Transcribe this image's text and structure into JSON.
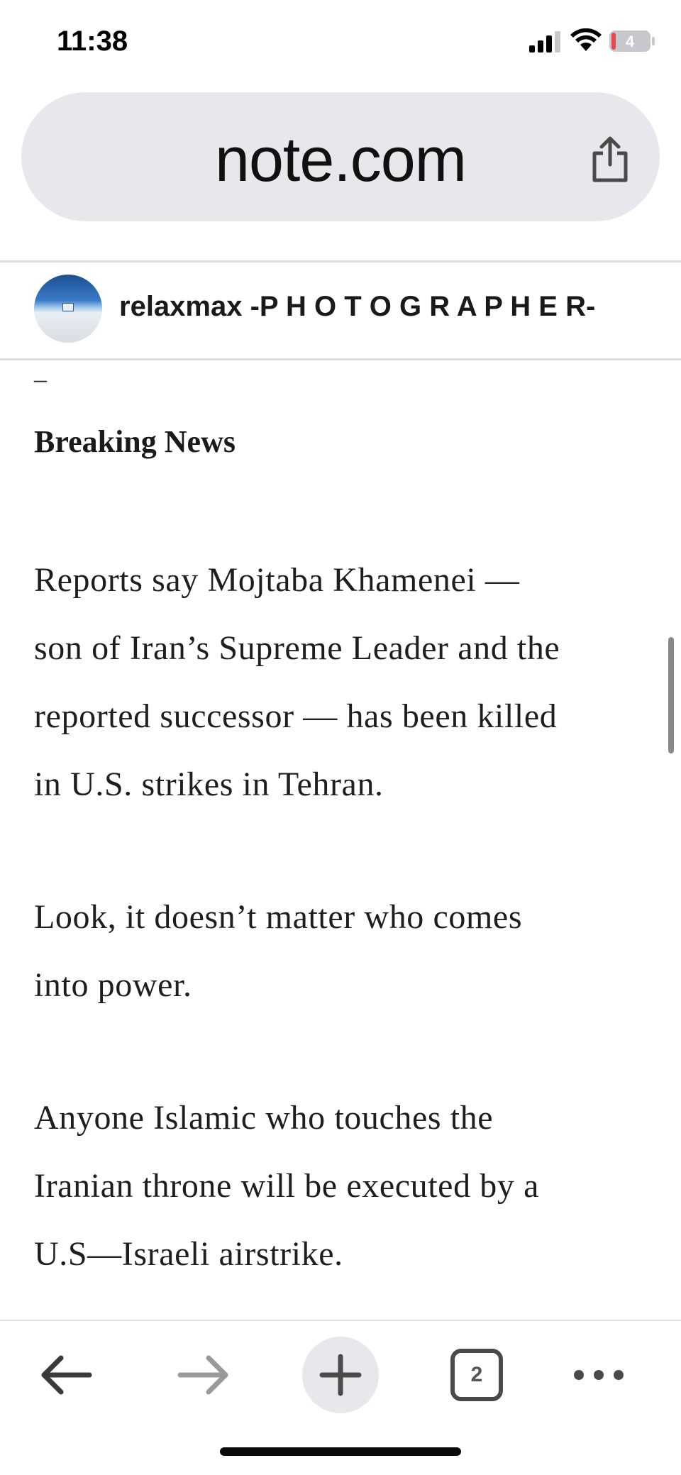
{
  "status_bar": {
    "time": "11:38",
    "battery_level": "4",
    "icons": [
      "signal-icon",
      "wifi-icon",
      "battery-icon"
    ]
  },
  "address_bar": {
    "url": "note.com",
    "share_icon": "share-icon"
  },
  "author": {
    "name": "relaxmax -P H O T O G R A P H E R-"
  },
  "article": {
    "separator": "–",
    "heading": "Breaking News",
    "paragraphs": [
      {
        "lines": [
          "Reports say Mojtaba Khamenei —",
          "son of Iran’s Supreme Leader and the",
          "reported successor — has been killed",
          "in U.S. strikes in Tehran."
        ]
      },
      {
        "lines": [
          "Look, it doesn’t matter who comes",
          "into power."
        ]
      },
      {
        "lines": [
          "Anyone Islamic who touches the",
          "Iranian throne will be executed by a",
          "U.S—Israeli airstrike."
        ]
      }
    ]
  },
  "toolbar": {
    "tab_count": "2",
    "icons": [
      "back-arrow-icon",
      "forward-arrow-icon",
      "plus-icon",
      "tabs-icon",
      "more-icon"
    ]
  },
  "colors": {
    "address_bar_bg": "#e6e8eb",
    "battery_low": "#e5484d",
    "forward_disabled": "#9a9a9a"
  }
}
